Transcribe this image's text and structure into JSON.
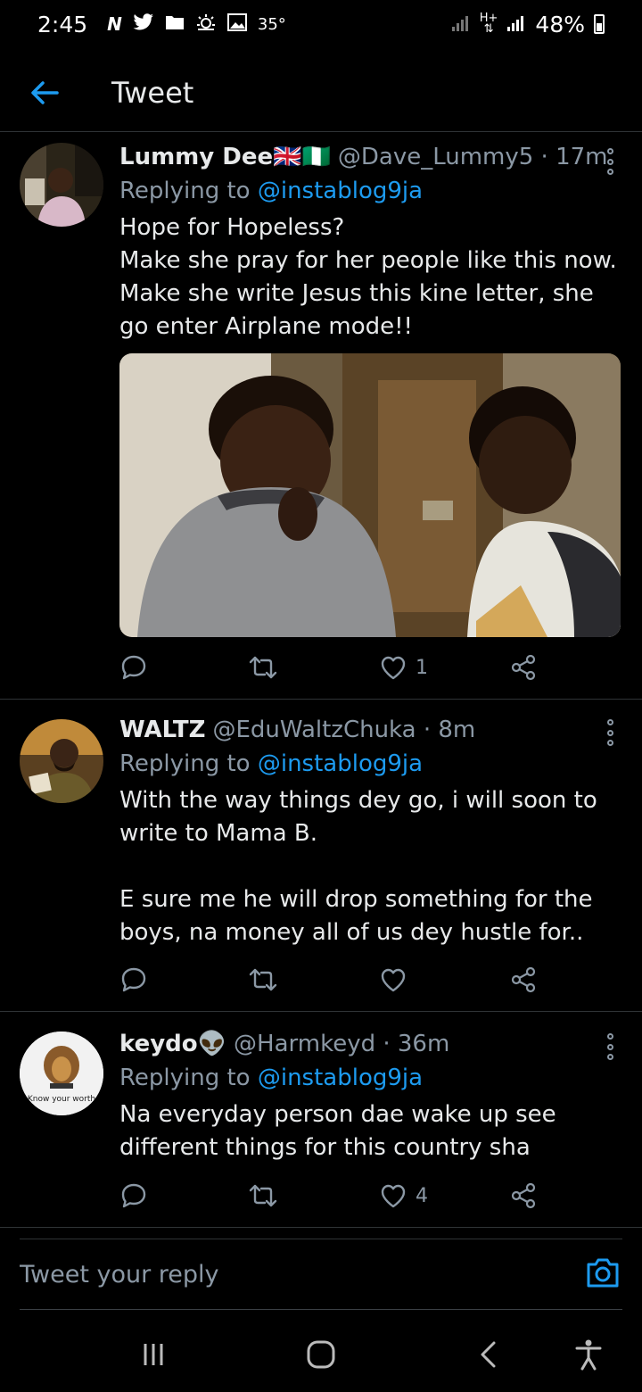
{
  "status_bar": {
    "time": "2:45",
    "temperature": "35°",
    "battery": "48%",
    "icons": [
      "n-icon",
      "twitter-icon",
      "folder-icon",
      "weather-icon",
      "gallery-icon"
    ]
  },
  "header": {
    "title": "Tweet"
  },
  "tweets": [
    {
      "display_name": "Lummy Dee🇬🇧🇳🇬",
      "handle": "@Dave_Lummy5",
      "time": "17m",
      "replying_prefix": "Replying to",
      "replying_to": "@instablog9ja",
      "text": "Hope for Hopeless?\nMake she pray for her people like this now.\nMake she write Jesus this kine letter, she go enter Airplane mode!!",
      "has_media": true,
      "likes": "1",
      "retweets": "",
      "replies": ""
    },
    {
      "display_name": "WALTZ",
      "handle": "@EduWaltzChuka",
      "time": "8m",
      "replying_prefix": "Replying to",
      "replying_to": "@instablog9ja",
      "text": "With the way things dey go, i will soon to write to Mama B.\n\nE sure me he will drop something for the boys, na money all of us dey hustle for..",
      "has_media": false,
      "likes": "",
      "retweets": "",
      "replies": ""
    },
    {
      "display_name": "keydo👽",
      "handle": "@Harmkeyd",
      "time": "36m",
      "replying_prefix": "Replying to",
      "replying_to": "@instablog9ja",
      "text": "Na everyday person dae wake up see different things for this country sha",
      "has_media": false,
      "likes": "4",
      "retweets": "",
      "replies": "",
      "avatar_caption": "Know your worth"
    }
  ],
  "reply_bar": {
    "placeholder": "Tweet your reply"
  },
  "colors": {
    "background": "#000000",
    "accent": "#1d9bf0",
    "secondary_text": "#8b98a5",
    "divider": "#2f3336"
  }
}
